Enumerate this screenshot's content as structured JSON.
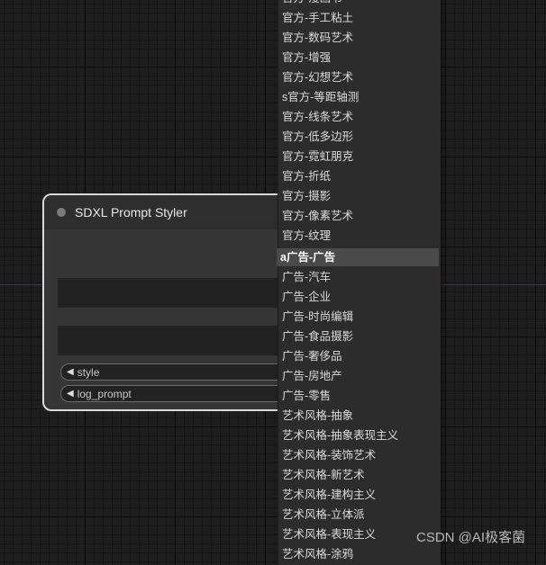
{
  "node": {
    "title": "SDXL Prompt Styler",
    "inputs": [
      {
        "name": "style"
      },
      {
        "name": "log_prompt"
      }
    ]
  },
  "menu": {
    "items": [
      "官方-漫画书",
      "官方-手工粘土",
      "官方-数码艺术",
      "官方-增强",
      "官方-幻想艺术",
      "s官方-等距轴测",
      "官方-线条艺术",
      "官方-低多边形",
      "官方-霓虹朋克",
      "官方-折纸",
      "官方-摄影",
      "官方-像素艺术",
      "官方-纹理",
      "a广告-广告",
      "广告-汽车",
      "广告-企业",
      "广告-时尚编辑",
      "广告-食品摄影",
      "广告-奢侈品",
      "广告-房地产",
      "广告-零售",
      "艺术风格-抽象",
      "艺术风格-抽象表现主义",
      "艺术风格-装饰艺术",
      "艺术风格-新艺术",
      "艺术风格-建构主义",
      "艺术风格-立体派",
      "艺术风格-表现主义",
      "艺术风格-涂鸦"
    ],
    "selected_index": 13
  },
  "watermark": "CSDN @AI极客菌"
}
